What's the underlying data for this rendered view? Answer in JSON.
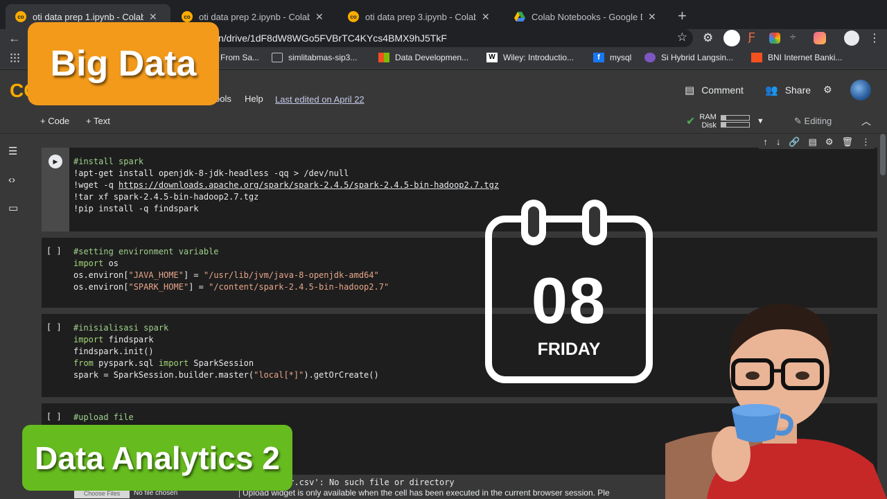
{
  "tabs": [
    {
      "label": "oti data prep 1.ipynb - Colabora",
      "active": true
    },
    {
      "label": "oti data prep 2.ipynb - Colabora",
      "active": false
    },
    {
      "label": "oti data prep 3.ipynb - Colabora",
      "active": false
    },
    {
      "label": "Colab Notebooks - Google Drive",
      "active": false
    }
  ],
  "address_bar": {
    "url": "n/drive/1dF8dW8WGo5FVBrTC4KYcs4BMX9hJ5TkF"
  },
  "bookmarks": [
    {
      "label": "From Sa..."
    },
    {
      "label": "simlitabmas-sip3..."
    },
    {
      "label": "Data Developmen..."
    },
    {
      "label": "Wiley: Introductio..."
    },
    {
      "label": "mysql"
    },
    {
      "label": "Si Hybrid Langsin..."
    },
    {
      "label": "BNI Internet Banki..."
    }
  ],
  "menu": {
    "tools": "ools",
    "help": "Help",
    "last_edited": "Last edited on April 22"
  },
  "header": {
    "comment": "Comment",
    "share": "Share"
  },
  "cell_toolbar": {
    "add_code": "+ Code",
    "add_text": "+ Text",
    "ram": "RAM",
    "disk": "Disk",
    "editing": "Editing"
  },
  "cells": [
    {
      "exec": "",
      "lines": [
        [
          {
            "t": "#install spark",
            "c": "c"
          }
        ],
        [
          {
            "t": "!apt-get install openjdk-8-jdk-headless -qq > /dev/null",
            "c": ""
          }
        ],
        [
          {
            "t": "!wget -q ",
            "c": ""
          },
          {
            "t": "https://downloads.apache.org/spark/spark-2.4.5/spark-2.4.5-bin-hadoop2.7.tgz",
            "c": "u"
          }
        ],
        [
          {
            "t": "!tar xf spark-2.4.5-bin-hadoop2.7.tgz",
            "c": ""
          }
        ],
        [
          {
            "t": "!pip install -q findspark",
            "c": ""
          }
        ]
      ]
    },
    {
      "exec": "[ ]",
      "lines": [
        [
          {
            "t": "#setting environment variable",
            "c": "c"
          }
        ],
        [
          {
            "t": "import",
            "c": "k"
          },
          {
            "t": " os",
            "c": ""
          }
        ],
        [
          {
            "t": "os.environ[",
            "c": ""
          },
          {
            "t": "\"JAVA_HOME\"",
            "c": "s"
          },
          {
            "t": "] = ",
            "c": ""
          },
          {
            "t": "\"/usr/lib/jvm/java-8-openjdk-amd64\"",
            "c": "s"
          }
        ],
        [
          {
            "t": "os.environ[",
            "c": ""
          },
          {
            "t": "\"SPARK_HOME\"",
            "c": "s"
          },
          {
            "t": "] = ",
            "c": ""
          },
          {
            "t": "\"/content/spark-2.4.5-bin-hadoop2.7\"",
            "c": "s"
          }
        ]
      ]
    },
    {
      "exec": "[ ]",
      "lines": [
        [
          {
            "t": "#inisialisasi spark",
            "c": "c"
          }
        ],
        [
          {
            "t": "import",
            "c": "k"
          },
          {
            "t": " findspark",
            "c": ""
          }
        ],
        [
          {
            "t": "findspark.init()",
            "c": ""
          }
        ],
        [
          {
            "t": "from",
            "c": "k"
          },
          {
            "t": " pyspark.sql ",
            "c": ""
          },
          {
            "t": "import",
            "c": "k"
          },
          {
            "t": " SparkSession",
            "c": ""
          }
        ],
        [
          {
            "t": "spark = SparkSession.builder.master(",
            "c": ""
          },
          {
            "t": "\"local[*]\"",
            "c": "s"
          },
          {
            "t": ").getOrCreate()",
            "c": ""
          }
        ]
      ]
    },
    {
      "exec": "[ ]",
      "lines": [
        [
          {
            "t": "#upload file",
            "c": "c"
          }
        ]
      ]
    }
  ],
  "output": {
    "error": "er.csv': No such file or directory",
    "choose_files": "Choose Files",
    "no_file": "No file chosen",
    "widget_msg": "Upload widget is only available when the cell has been executed in the current browser session. Ple"
  },
  "overlays": {
    "big_data": "Big Data",
    "data_analytics": "Data Analytics 2",
    "calendar_day": "08",
    "calendar_weekday": "FRIDAY"
  },
  "colors": {
    "orange_badge": "#f39a1b",
    "green_badge": "#66bb1f",
    "colab_dark": "#383838",
    "code_bg": "#1e1e1e"
  }
}
